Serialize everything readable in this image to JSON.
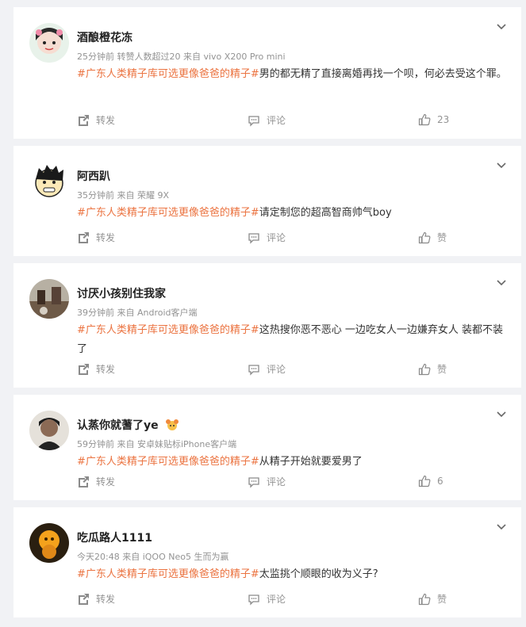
{
  "posts": [
    {
      "username": "酒酿橙花冻",
      "meta": "25分钟前  转赞人数超过20  来自 vivo X200 Pro mini",
      "hashtag": "#广东人类精子库可选更像爸爸的精子#",
      "body": "男的都无精了直接离婚再找一个呗，何必去受这个罪。",
      "repost_label": "转发",
      "comment_label": "评论",
      "like_label": "23"
    },
    {
      "username": "阿西趴",
      "meta": "35分钟前  来自 荣耀 9X",
      "hashtag": "#广东人类精子库可选更像爸爸的精子#",
      "body": "请定制您的超高智商帅气boy",
      "repost_label": "转发",
      "comment_label": "评论",
      "like_label": "赞"
    },
    {
      "username": "讨厌小孩别住我家",
      "meta": "39分钟前  来自 Android客户端",
      "hashtag": "#广东人类精子库可选更像爸爸的精子#",
      "body": "这热搜你恶不恶心 一边吃女人一边嫌弃女人 装都不装了",
      "repost_label": "转发",
      "comment_label": "评论",
      "like_label": "赞"
    },
    {
      "username": "认蒸你就蓍了ye",
      "meta": "59分钟前  来自 安卓妹贴标iPhone客户端",
      "hashtag": "#广东人类精子库可选更像爸爸的精子#",
      "body": "从精子开始就要爱男了",
      "repost_label": "转发",
      "comment_label": "评论",
      "like_label": "6"
    },
    {
      "username": "吃瓜路人1111",
      "meta": "今天20:48  来自 iQOO Neo5 生而为赢",
      "hashtag": "#广东人类精子库可选更像爸爸的精子#",
      "body": "太监挑个顺眼的收为义子?",
      "repost_label": "转发",
      "comment_label": "评论",
      "like_label": "赞"
    }
  ],
  "colors": {
    "hashtag": "#eb7340",
    "meta": "#939393",
    "background": "#f1f2f5"
  },
  "icons": [
    "chevron-down-icon",
    "repost-icon",
    "comment-icon",
    "like-icon",
    "badge-emoji-icon"
  ]
}
